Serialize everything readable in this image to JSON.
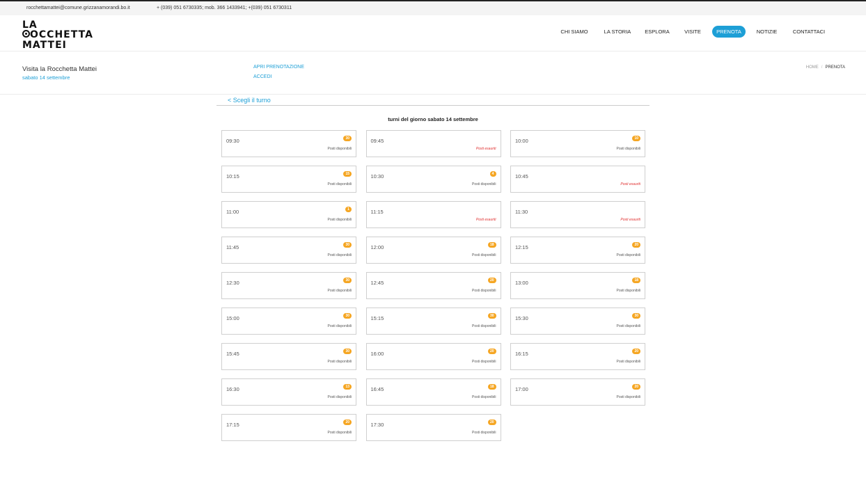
{
  "topbar": {
    "email": "rocchettamattei@comune.grizzanamorandi.bo.it",
    "phones": "+ (039) 051 6730335; mob. 366 1433941; +(039) 051 6730311"
  },
  "logo": {
    "line1": "LA",
    "line2_rest": "OCCHETTA",
    "line3": "MATTEI"
  },
  "nav": [
    "CHI SIAMO",
    "LA STORIA",
    "ESPLORA",
    "VISITE",
    "PRENOTA",
    "NOTIZIE",
    "CONTATTACI"
  ],
  "subheader": {
    "title": "Visita la Rocchetta Mattei",
    "date": "sabato 14 settembre",
    "link_open": "APRI PRENOTAZIONE",
    "link_login": "ACCEDI",
    "breadcrumb_home": "HOME",
    "breadcrumb_sep": "/",
    "breadcrumb_current": "PRENOTA"
  },
  "booking": {
    "back_label": "< Scegli il turno",
    "day_title": "turni del giorno sabato 14 settembre",
    "available_label": "Posti disponibili",
    "full_label": "Posti esauriti"
  },
  "slots": [
    {
      "time": "09:30",
      "seats": "30"
    },
    {
      "time": "09:45",
      "seats": null
    },
    {
      "time": "10:00",
      "seats": "10"
    },
    {
      "time": "10:15",
      "seats": "15"
    },
    {
      "time": "10:30",
      "seats": "4"
    },
    {
      "time": "10:45",
      "seats": null
    },
    {
      "time": "11:00",
      "seats": "1"
    },
    {
      "time": "11:15",
      "seats": null
    },
    {
      "time": "11:30",
      "seats": null
    },
    {
      "time": "11:45",
      "seats": "30"
    },
    {
      "time": "12:00",
      "seats": "18"
    },
    {
      "time": "12:15",
      "seats": "20"
    },
    {
      "time": "12:30",
      "seats": "30"
    },
    {
      "time": "12:45",
      "seats": "20"
    },
    {
      "time": "13:00",
      "seats": "18"
    },
    {
      "time": "15:00",
      "seats": "30"
    },
    {
      "time": "15:15",
      "seats": "30"
    },
    {
      "time": "15:30",
      "seats": "30"
    },
    {
      "time": "15:45",
      "seats": "30"
    },
    {
      "time": "16:00",
      "seats": "20"
    },
    {
      "time": "16:15",
      "seats": "20"
    },
    {
      "time": "16:30",
      "seats": "13"
    },
    {
      "time": "16:45",
      "seats": "18"
    },
    {
      "time": "17:00",
      "seats": "20"
    },
    {
      "time": "17:15",
      "seats": "20"
    },
    {
      "time": "17:30",
      "seats": "20"
    }
  ],
  "colors": {
    "accent": "#1d9fd6",
    "badge": "#f5a623",
    "sold_out": "#e03030"
  }
}
